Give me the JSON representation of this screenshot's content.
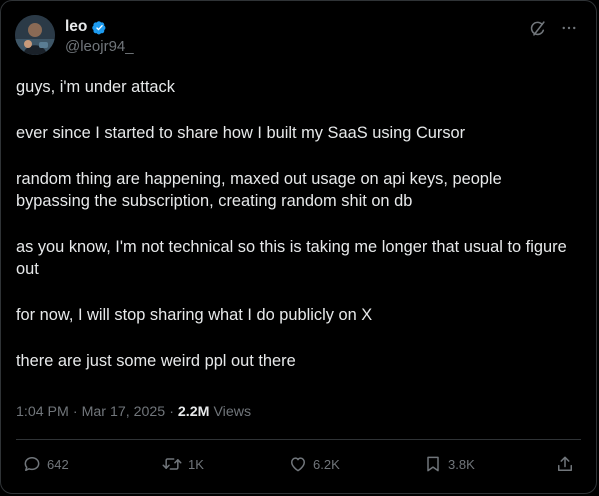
{
  "author": {
    "display_name": "leo",
    "handle": "@leojr94_",
    "verified": true,
    "avatar_icon": "avatar-photo"
  },
  "colors": {
    "background": "#000000",
    "text": "#e7e9ea",
    "muted": "#71767b",
    "verified": "#1d9bf0",
    "border": "#2f3336"
  },
  "post": {
    "paragraphs": [
      "guys, i'm under attack",
      "ever since I started to share how I built my SaaS using Cursor",
      "random thing are happening, maxed out usage on api keys, people bypassing the subscription, creating random shit on db",
      "as you know, I'm not technical so this is taking me longer that usual to figure out",
      "for now, I will stop sharing what I do publicly on X",
      "there are just some weird ppl out there"
    ],
    "time": "1:04 PM",
    "date": "Mar 17, 2025",
    "separator": "·",
    "views_count": "2.2M",
    "views_label": "Views"
  },
  "actions": {
    "replies": "642",
    "reposts": "1K",
    "likes": "6.2K",
    "bookmarks": "3.8K"
  },
  "icons": {
    "grok": "grok-icon",
    "more": "more-icon",
    "reply": "reply-icon",
    "repost": "repost-icon",
    "like": "heart-icon",
    "bookmark": "bookmark-icon",
    "share": "share-icon"
  }
}
